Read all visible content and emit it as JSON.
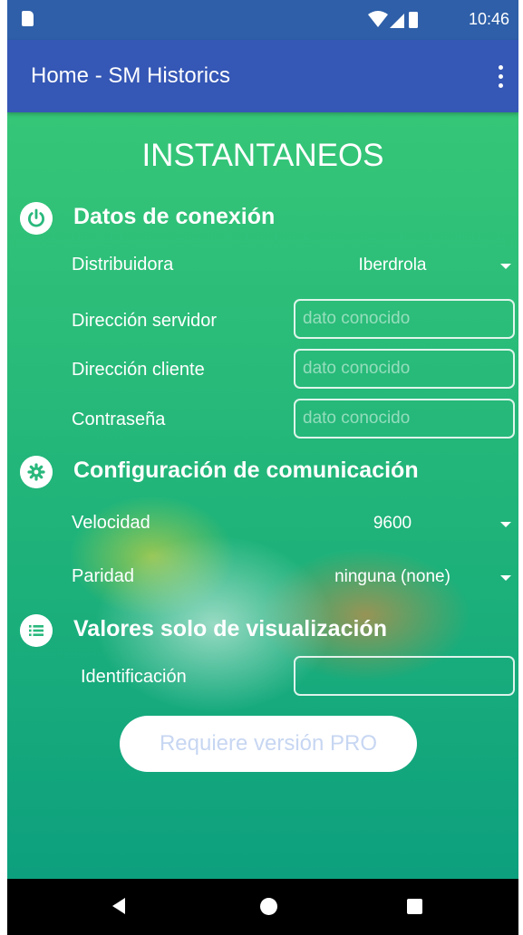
{
  "status_bar": {
    "time": "10:46"
  },
  "app_bar": {
    "title": "Home - SM Historics"
  },
  "main": {
    "heading": "INSTANTANEOS",
    "connection": {
      "title": "Datos de conexión",
      "distribuidora": {
        "label": "Distribuidora",
        "value": "Iberdrola"
      },
      "server_address": {
        "label": "Dirección servidor",
        "value": "",
        "placeholder": "dato conocido"
      },
      "client_address": {
        "label": "Dirección cliente",
        "value": "",
        "placeholder": "dato conocido"
      },
      "password": {
        "label": "Contraseña",
        "value": "",
        "placeholder": "dato conocido"
      }
    },
    "communication": {
      "title": "Configuración de comunicación",
      "speed": {
        "label": "Velocidad",
        "value": "9600"
      },
      "parity": {
        "label": "Paridad",
        "value": "ninguna (none)"
      }
    },
    "display_only": {
      "title": "Valores solo de visualización",
      "identification": {
        "label": "Identificación",
        "value": "",
        "placeholder": ""
      }
    },
    "pro_button_label": "Requiere versión PRO"
  },
  "icons": {
    "status": [
      "sd-card-icon",
      "wifi-icon",
      "signal-icon",
      "battery-icon"
    ],
    "sections": [
      "power-icon",
      "settings-icon",
      "list-icon"
    ],
    "nav": [
      "back-icon",
      "home-icon",
      "recents-icon"
    ]
  },
  "colors": {
    "status_bar": "#2e5fa8",
    "app_bar": "#3557b5",
    "background": "#2ab77a",
    "section_icon": "#29b87c",
    "pro_button_text": "#c7d6f2"
  }
}
